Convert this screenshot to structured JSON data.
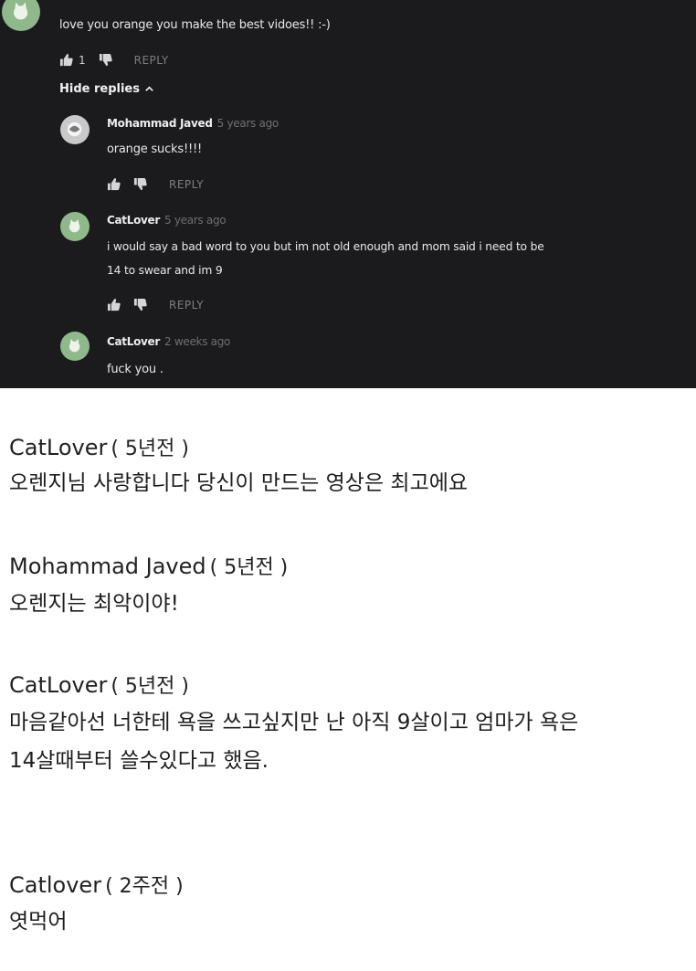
{
  "thread": {
    "top_comment": {
      "text": "love you orange you make the best vidoes!! :-)",
      "likes": "1",
      "reply_label": "REPLY"
    },
    "hide_replies_label": "Hide replies",
    "replies": [
      {
        "author": "Mohammad Javed",
        "time": "5 years ago",
        "text_lines": [
          "orange sucks!!!!"
        ],
        "reply_label": "REPLY"
      },
      {
        "author": "CatLover",
        "time": "5 years ago",
        "text_lines": [
          "i would say a bad word to you but im not old enough and mom said i need to be",
          "14 to swear and im 9"
        ],
        "reply_label": "REPLY"
      },
      {
        "author": "CatLover",
        "time": "2 weeks ago",
        "text_lines": [
          "fuck you ."
        ]
      }
    ]
  },
  "translation": [
    {
      "author": "CatLover",
      "time": "( 5년전 )",
      "lines": [
        "오렌지님 사랑합니다 당신이 만드는 영상은 최고에요"
      ]
    },
    {
      "author": "Mohammad Javed",
      "time": "( 5년전 )",
      "lines": [
        "오렌지는 최악이야!"
      ]
    },
    {
      "author": "CatLover",
      "time": "( 5년전 )",
      "lines": [
        "마음같아선 너한테 욕을 쓰고싶지만 난 아직 9살이고 엄마가 욕은",
        "14살때부터 쓸수있다고 했음."
      ]
    },
    {
      "author": "Catlover",
      "time": "( 2주전 )",
      "lines": [
        "엿먹어"
      ]
    }
  ],
  "colors": {
    "dark_bg": "#1b1b1d",
    "avatar_green": "#8fb88b",
    "time_gray": "#6f6f6f"
  },
  "icons": [
    "thumbs-up-icon",
    "thumbs-down-icon",
    "chevron-up-icon",
    "cat-avatar-icon",
    "default-avatar-icon"
  ]
}
